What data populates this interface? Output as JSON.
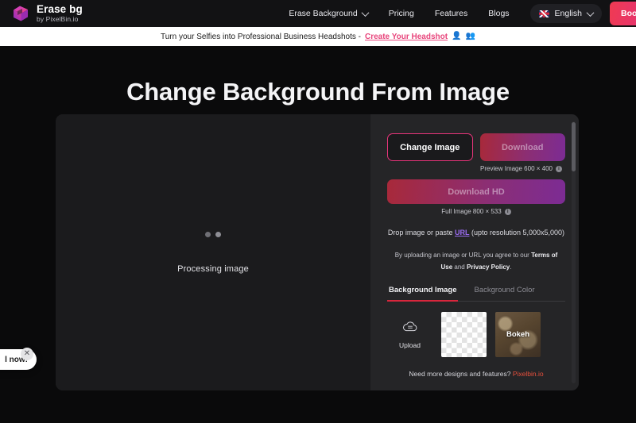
{
  "header": {
    "brand": {
      "title": "Erase bg",
      "subtitle": "by PixelBin.io",
      "logo_icon": "cube-logo-icon"
    },
    "nav": [
      {
        "label": "Erase Background",
        "has_dropdown": true
      },
      {
        "label": "Pricing",
        "has_dropdown": false
      },
      {
        "label": "Features",
        "has_dropdown": false
      },
      {
        "label": "Blogs",
        "has_dropdown": false
      }
    ],
    "language": {
      "label": "English",
      "flag": "uk-flag-icon"
    },
    "cta": {
      "label": "Book a"
    }
  },
  "banner": {
    "text": "Turn your Selfies into Professional Business Headshots - ",
    "link": "Create Your Headshot",
    "emoji1": "👤",
    "emoji2": "👥"
  },
  "page": {
    "title": "Change Background From Image"
  },
  "preview": {
    "status": "Processing image"
  },
  "tools": {
    "change_image": "Change Image",
    "download": "Download",
    "preview_caption": "Preview Image 600 × 400",
    "download_hd": "Download HD",
    "full_caption": "Full Image 800 × 533",
    "info_glyph": "i",
    "drop_text_before": "Drop image or paste ",
    "drop_link": "URL",
    "drop_text_after": " (upto resolution 5,000x5,000)",
    "terms_before": "By uploading an image or URL you agree to our ",
    "terms_link": "Terms of Use",
    "terms_mid": " and ",
    "privacy_link": "Privacy Policy",
    "terms_end": ".",
    "tabs": [
      {
        "label": "Background Image",
        "active": true
      },
      {
        "label": "Background Color",
        "active": false
      }
    ],
    "thumbnails": [
      {
        "label": "Upload",
        "type": "upload",
        "icon": "upload-cloud-icon"
      },
      {
        "label": "",
        "type": "transparent"
      },
      {
        "label": "Bokeh",
        "type": "bokeh"
      }
    ],
    "more_text": "Need more designs and features? ",
    "more_link": "Pixelbin.io"
  },
  "chat": {
    "text": "l now!",
    "close_glyph": "✕"
  },
  "colors": {
    "accent_pink": "#e8357b",
    "accent_red": "#d8263c",
    "accent_purple": "#9a6cf0",
    "panel_bg": "#252527",
    "canvas_bg": "#1b1b1d",
    "page_bg": "#0a0a0b"
  }
}
